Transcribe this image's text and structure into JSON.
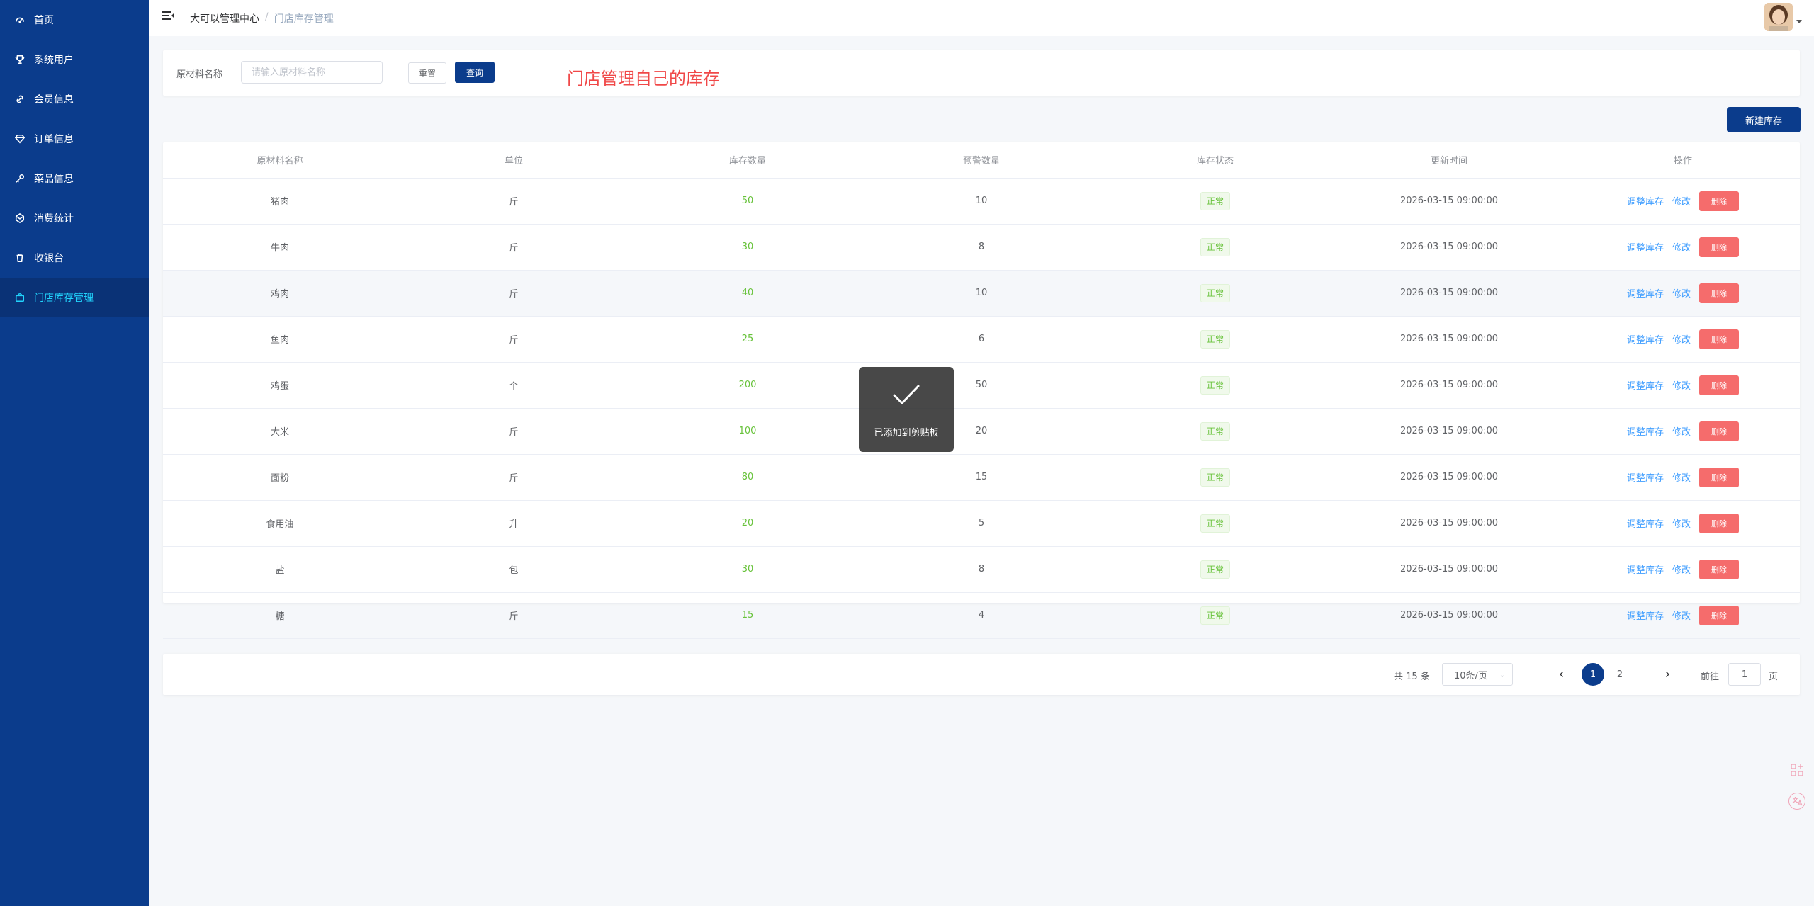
{
  "sidebar": {
    "items": [
      {
        "label": "首页",
        "icon": "dashboard-icon"
      },
      {
        "label": "系统用户",
        "icon": "trophy-icon"
      },
      {
        "label": "会员信息",
        "icon": "link-icon"
      },
      {
        "label": "订单信息",
        "icon": "diamond-icon"
      },
      {
        "label": "菜品信息",
        "icon": "key-icon"
      },
      {
        "label": "消费统计",
        "icon": "gem-icon"
      },
      {
        "label": "收银台",
        "icon": "trash-icon"
      },
      {
        "label": "门店库存管理",
        "icon": "bag-icon"
      }
    ],
    "active_index": 7,
    "bg_color": "#0b3c8c",
    "active_color": "#21d4fd"
  },
  "header": {
    "breadcrumb_home": "大可以管理中心",
    "breadcrumb_sep": "/",
    "breadcrumb_current": "门店库存管理"
  },
  "search": {
    "label": "原材料名称",
    "placeholder": "请输入原材料名称",
    "reset_label": "重置",
    "query_label": "查询"
  },
  "annotation": "门店管理自己的库存",
  "new_button_label": "新建库存",
  "table": {
    "columns": [
      "原材料名称",
      "单位",
      "库存数量",
      "预警数量",
      "库存状态",
      "更新时间",
      "操作"
    ],
    "rows": [
      {
        "name": "猪肉",
        "unit": "斤",
        "stock": "50",
        "warn": "10",
        "status": "正常",
        "updated": "2026-03-15 09:00:00"
      },
      {
        "name": "牛肉",
        "unit": "斤",
        "stock": "30",
        "warn": "8",
        "status": "正常",
        "updated": "2026-03-15 09:00:00"
      },
      {
        "name": "鸡肉",
        "unit": "斤",
        "stock": "40",
        "warn": "10",
        "status": "正常",
        "updated": "2026-03-15 09:00:00"
      },
      {
        "name": "鱼肉",
        "unit": "斤",
        "stock": "25",
        "warn": "6",
        "status": "正常",
        "updated": "2026-03-15 09:00:00"
      },
      {
        "name": "鸡蛋",
        "unit": "个",
        "stock": "200",
        "warn": "50",
        "status": "正常",
        "updated": "2026-03-15 09:00:00"
      },
      {
        "name": "大米",
        "unit": "斤",
        "stock": "100",
        "warn": "20",
        "status": "正常",
        "updated": "2026-03-15 09:00:00"
      },
      {
        "name": "面粉",
        "unit": "斤",
        "stock": "80",
        "warn": "15",
        "status": "正常",
        "updated": "2026-03-15 09:00:00"
      },
      {
        "name": "食用油",
        "unit": "升",
        "stock": "20",
        "warn": "5",
        "status": "正常",
        "updated": "2026-03-15 09:00:00"
      },
      {
        "name": "盐",
        "unit": "包",
        "stock": "30",
        "warn": "8",
        "status": "正常",
        "updated": "2026-03-15 09:00:00"
      },
      {
        "name": "糖",
        "unit": "斤",
        "stock": "15",
        "warn": "4",
        "status": "正常",
        "updated": "2026-03-15 09:00:00"
      }
    ],
    "action_adjust": "调整库存",
    "action_edit": "修改",
    "action_delete": "删除"
  },
  "pagination": {
    "total_text": "共 15 条",
    "page_size": "10条/页",
    "pages": [
      "1",
      "2"
    ],
    "current_page": "1",
    "goto_label": "前往",
    "goto_value": "1",
    "goto_suffix": "页"
  },
  "toast": {
    "text": "已添加到剪贴板",
    "icon": "check-icon"
  }
}
